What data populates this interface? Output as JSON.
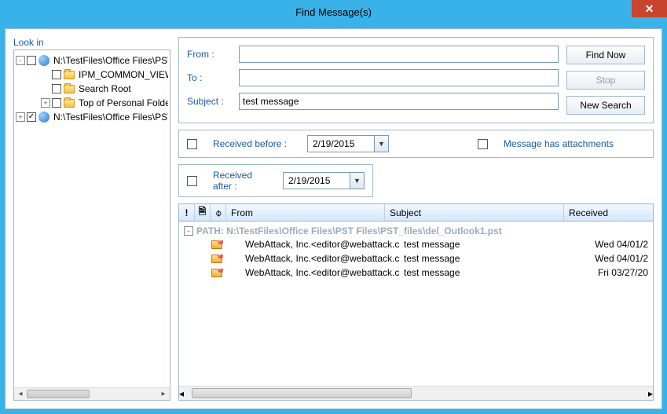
{
  "window": {
    "title": "Find Message(s)"
  },
  "leftPanel": {
    "label": "Look in",
    "nodes": [
      {
        "expander": "-",
        "checked": false,
        "icon": "pst",
        "label": "N:\\TestFiles\\Office Files\\PST",
        "indent": 0
      },
      {
        "expander": "",
        "checked": false,
        "icon": "folder",
        "label": "IPM_COMMON_VIEWS",
        "indent": 2
      },
      {
        "expander": "",
        "checked": false,
        "icon": "folder",
        "label": "Search Root",
        "indent": 2
      },
      {
        "expander": "+",
        "checked": false,
        "icon": "folder",
        "label": "Top of Personal Folders",
        "indent": 2
      },
      {
        "expander": "+",
        "checked": true,
        "icon": "pst",
        "label": "N:\\TestFiles\\Office Files\\PST",
        "indent": 0
      }
    ]
  },
  "search": {
    "fromLabel": "From :",
    "toLabel": "To :",
    "subjectLabel": "Subject :",
    "fromValue": "",
    "toValue": "",
    "subjectValue": "test message",
    "buttons": {
      "findNow": "Find Now",
      "stop": "Stop",
      "newSearch": "New Search"
    },
    "receivedBefore": {
      "label": "Received before :",
      "date": "2/19/2015"
    },
    "receivedAfter": {
      "label": "Received after :",
      "date": "2/19/2015"
    },
    "attachments": {
      "label": "Message has attachments"
    }
  },
  "results": {
    "headers": {
      "priority": "!",
      "icon": "",
      "attach": "",
      "from": "From",
      "subject": "Subject",
      "received": "Received"
    },
    "pathLabel": "PATH:  N:\\TestFiles\\Office Files\\PST Files\\PST_files\\del_Outlook1.pst",
    "rows": [
      {
        "from": "WebAttack, Inc.<editor@webattack.c...",
        "subject": "test message",
        "received": "Wed 04/01/2"
      },
      {
        "from": "WebAttack, Inc.<editor@webattack.c...",
        "subject": "test message",
        "received": "Wed 04/01/2"
      },
      {
        "from": "WebAttack, Inc.<editor@webattack.c...",
        "subject": "test message",
        "received": "Fri 03/27/20"
      }
    ]
  },
  "icons": {
    "pageIcon": "🗎",
    "attachIcon": "📎"
  }
}
